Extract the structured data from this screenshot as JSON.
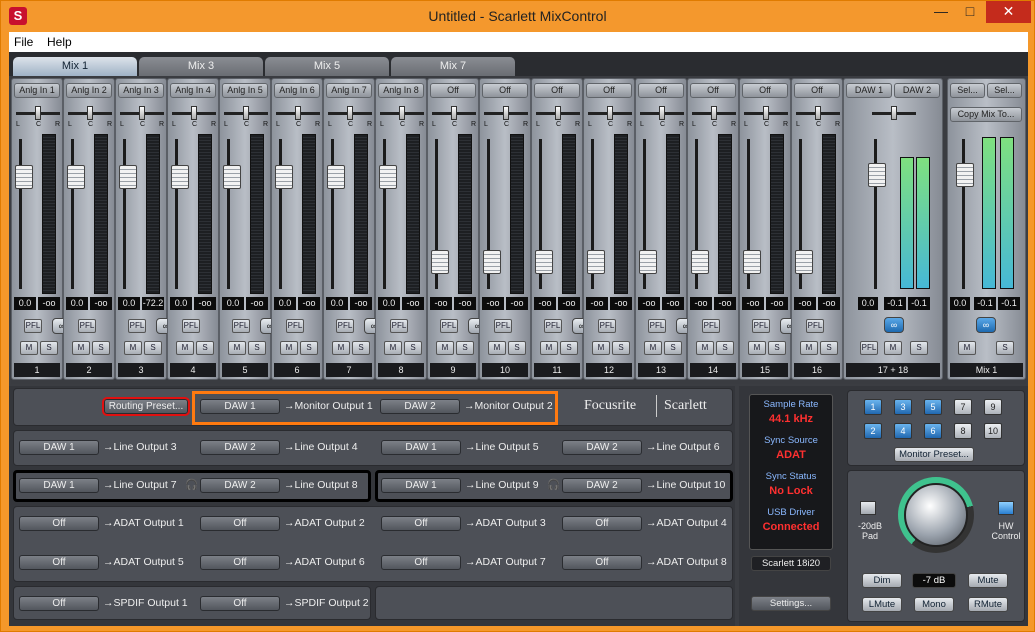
{
  "window": {
    "title": "Untitled - Scarlett MixControl",
    "minimize": "—",
    "maximize": "□",
    "close": "✕"
  },
  "menu": [
    "File",
    "Help"
  ],
  "tabs": [
    "Mix 1",
    "Mix 3",
    "Mix 5",
    "Mix 7"
  ],
  "channels": [
    {
      "input": "Anlg In 1",
      "value": "0.0",
      "value2": "-oo",
      "label": "1",
      "fader": 0.75
    },
    {
      "input": "Anlg In 2",
      "value": "0.0",
      "value2": "-oo",
      "label": "2",
      "fader": 0.75
    },
    {
      "input": "Anlg In 3",
      "value": "0.0",
      "value2": "-72.2",
      "label": "3",
      "fader": 0.75
    },
    {
      "input": "Anlg In 4",
      "value": "0.0",
      "value2": "-oo",
      "label": "4",
      "fader": 0.75
    },
    {
      "input": "Anlg In 5",
      "value": "0.0",
      "value2": "-oo",
      "label": "5",
      "fader": 0.75
    },
    {
      "input": "Anlg In 6",
      "value": "0.0",
      "value2": "-oo",
      "label": "6",
      "fader": 0.75
    },
    {
      "input": "Anlg In 7",
      "value": "0.0",
      "value2": "-oo",
      "label": "7",
      "fader": 0.75
    },
    {
      "input": "Anlg In 8",
      "value": "0.0",
      "value2": "-oo",
      "label": "8",
      "fader": 0.75
    },
    {
      "input": "Off",
      "value": "-oo",
      "value2": "-oo",
      "label": "9",
      "fader": 0.18
    },
    {
      "input": "Off",
      "value": "-oo",
      "value2": "-oo",
      "label": "10",
      "fader": 0.18
    },
    {
      "input": "Off",
      "value": "-oo",
      "value2": "-oo",
      "label": "11",
      "fader": 0.18
    },
    {
      "input": "Off",
      "value": "-oo",
      "value2": "-oo",
      "label": "12",
      "fader": 0.18
    },
    {
      "input": "Off",
      "value": "-oo",
      "value2": "-oo",
      "label": "13",
      "fader": 0.18
    },
    {
      "input": "Off",
      "value": "-oo",
      "value2": "-oo",
      "label": "14",
      "fader": 0.18
    },
    {
      "input": "Off",
      "value": "-oo",
      "value2": "-oo",
      "label": "15",
      "fader": 0.18
    },
    {
      "input": "Off",
      "value": "-oo",
      "value2": "-oo",
      "label": "16",
      "fader": 0.18
    }
  ],
  "strip_buttons": {
    "pfl": "PFL",
    "mute": "M",
    "solo": "S",
    "link": "∞",
    "pan_l": "L",
    "pan_c": "C",
    "pan_r": "R"
  },
  "daw_strip": {
    "in1": "DAW 1",
    "in2": "DAW 2",
    "v1": "0.0",
    "v2": "-0.1",
    "v3": "-0.1",
    "label": "17 + 18",
    "meter_level": 0.88
  },
  "mix_strip": {
    "sel1": "Sel...",
    "sel2": "Sel...",
    "copy": "Copy Mix To...",
    "v1": "0.0",
    "v2": "-0.1",
    "v3": "-0.1",
    "label": "Mix 1",
    "meter_level": 0.88
  },
  "routing": {
    "preset_btn": "Routing Preset...",
    "brand": "Focusrite",
    "brand2": "Scarlett",
    "monitor": [
      {
        "src": "DAW 1",
        "dst": "Monitor Output 1"
      },
      {
        "src": "DAW 2",
        "dst": "Monitor Output 2"
      }
    ],
    "line_row1": [
      {
        "src": "DAW 1",
        "dst": "Line Output 3"
      },
      {
        "src": "DAW 2",
        "dst": "Line Output 4"
      },
      {
        "src": "DAW 1",
        "dst": "Line Output 5"
      },
      {
        "src": "DAW 2",
        "dst": "Line Output 6"
      }
    ],
    "line_row2": [
      {
        "src": "DAW 1",
        "dst": "Line Output 7"
      },
      {
        "src": "DAW 2",
        "dst": "Line Output 8"
      },
      {
        "src": "DAW 1",
        "dst": "Line Output 9"
      },
      {
        "src": "DAW 2",
        "dst": "Line Output 10"
      }
    ],
    "adat_row1": [
      {
        "src": "Off",
        "dst": "ADAT Output 1"
      },
      {
        "src": "Off",
        "dst": "ADAT Output 2"
      },
      {
        "src": "Off",
        "dst": "ADAT Output 3"
      },
      {
        "src": "Off",
        "dst": "ADAT Output 4"
      }
    ],
    "adat_row2": [
      {
        "src": "Off",
        "dst": "ADAT Output 5"
      },
      {
        "src": "Off",
        "dst": "ADAT Output 6"
      },
      {
        "src": "Off",
        "dst": "ADAT Output 7"
      },
      {
        "src": "Off",
        "dst": "ADAT Output 8"
      }
    ],
    "spdif": [
      {
        "src": "Off",
        "dst": "SPDIF Output 1"
      },
      {
        "src": "Off",
        "dst": "SPDIF Output 2"
      }
    ],
    "arrow": "→",
    "headphone": "🎧"
  },
  "status": {
    "sample_rate_label": "Sample Rate",
    "sample_rate": "44.1 kHz",
    "sync_source_label": "Sync Source",
    "sync_source": "ADAT",
    "sync_status_label": "Sync Status",
    "sync_status": "No Lock",
    "usb_label": "USB  Driver",
    "usb": "Connected",
    "device": "Scarlett 18i20",
    "settings": "Settings..."
  },
  "monitor_ctrl": {
    "nums_top": [
      "1",
      "3",
      "5",
      "7",
      "9"
    ],
    "nums_bottom": [
      "2",
      "4",
      "6",
      "8",
      "10"
    ],
    "preset": "Monitor Preset...",
    "pad": "-20dB\nPad",
    "hw": "HW\nControl",
    "dim": "Dim",
    "level": "-7 dB",
    "mute": "Mute",
    "lmute": "LMute",
    "mono": "Mono",
    "rmute": "RMute"
  }
}
